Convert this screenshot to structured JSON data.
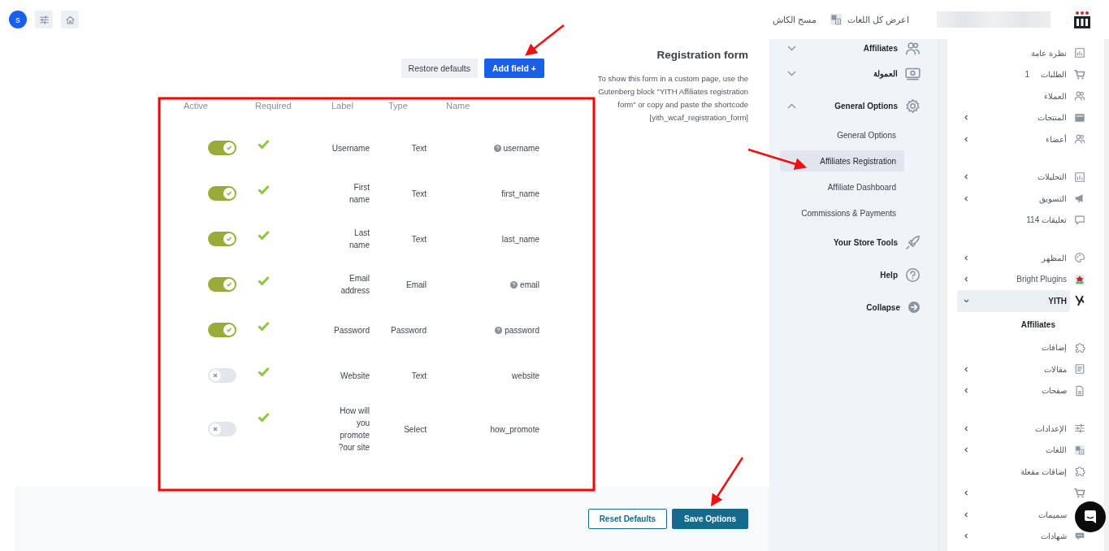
{
  "topbar": {
    "avatar": "s",
    "actions": [
      "اعرض كل اللغات",
      "مسح الكاش"
    ]
  },
  "admin_menu": {
    "groups": [
      {
        "items": [
          {
            "label": "نظرة عامة",
            "has_submenu": false,
            "selected": false
          },
          {
            "label": "الطلبات",
            "badge": "1",
            "has_submenu": false,
            "selected": false
          },
          {
            "label": "العملاء",
            "has_submenu": false,
            "selected": false
          },
          {
            "label": "المنتجات",
            "has_submenu": true,
            "selected": false
          },
          {
            "label": "أعضاء",
            "has_submenu": true,
            "selected": false
          }
        ]
      },
      {
        "items": [
          {
            "label": "التحليلات",
            "has_submenu": true,
            "selected": false
          },
          {
            "label": "التسويق",
            "has_submenu": true,
            "selected": false
          },
          {
            "label": "تعليقات 114",
            "has_submenu": false,
            "selected": false
          }
        ]
      },
      {
        "items": [
          {
            "label": "المظهر",
            "has_submenu": true,
            "selected": false
          },
          {
            "label": "Bright Plugins",
            "has_submenu": true,
            "selected": false
          },
          {
            "label": "YITH",
            "has_submenu": true,
            "selected": true,
            "children": [
              {
                "label": "Affiliates",
                "selected": true
              }
            ]
          },
          {
            "label": "إضافات",
            "has_submenu": false,
            "selected": false
          },
          {
            "label": "مقالات",
            "has_submenu": true,
            "selected": false
          },
          {
            "label": "صفحات",
            "has_submenu": true,
            "selected": false
          }
        ]
      },
      {
        "items": [
          {
            "label": "الإعدادات",
            "has_submenu": true,
            "selected": false
          },
          {
            "label": "اللغات",
            "has_submenu": true,
            "selected": false
          },
          {
            "label": "إضافات مفعلة",
            "has_submenu": false,
            "selected": false
          },
          {
            "has_submenu": true,
            "selected": false
          },
          {
            "label": "سميمات",
            "has_submenu": true,
            "selected": false
          },
          {
            "label": "شهادات",
            "has_submenu": true,
            "selected": false
          }
        ]
      }
    ]
  },
  "plugin_nav": [
    {
      "kind": "section",
      "label": "Affiliates",
      "expanded": false
    },
    {
      "kind": "section",
      "label": "العمولة",
      "expanded": false
    },
    {
      "kind": "section",
      "label": "General Options",
      "expanded": true,
      "children": [
        {
          "label": "General Options",
          "selected": false
        },
        {
          "label": "Affiliates Registration",
          "selected": true
        },
        {
          "label": "Affiliate Dashboard",
          "selected": false
        },
        {
          "label": "Commissions & Payments",
          "selected": false
        }
      ]
    },
    {
      "kind": "link",
      "label": "Your Store Tools"
    },
    {
      "kind": "link",
      "label": "Help"
    },
    {
      "kind": "link",
      "label": "Collapse"
    }
  ],
  "form": {
    "title": "Registration form",
    "description": "To show this form in a custom page, use the Gutenberg block \"YITH Affiliates registration form\" or copy and paste the shortcode [yith_wcaf_registration_form]",
    "buttons": [
      "Restore defaults",
      "Add field +"
    ],
    "table": {
      "columns": [
        "Active",
        "Required",
        "Label",
        "Type",
        "Name"
      ],
      "rows": [
        {
          "active": true,
          "required": true,
          "label": "Username",
          "type": "Text",
          "name": "username",
          "has_help": true
        },
        {
          "active": true,
          "required": true,
          "label": "First name",
          "type": "Text",
          "name": "first_name",
          "has_help": false
        },
        {
          "active": true,
          "required": true,
          "label": "Last name",
          "type": "Text",
          "name": "last_name",
          "has_help": false
        },
        {
          "active": true,
          "required": true,
          "label": "Email address",
          "type": "Email",
          "name": "email",
          "has_help": true
        },
        {
          "active": true,
          "required": true,
          "label": "Password",
          "type": "Password",
          "name": "password",
          "has_help": true
        },
        {
          "active": false,
          "required": true,
          "label": "Website",
          "type": "Text",
          "name": "website",
          "has_help": false
        },
        {
          "active": false,
          "required": true,
          "label": "How will you promote ?our site",
          "type": "Select",
          "name": "how_promote",
          "has_help": false
        }
      ]
    }
  },
  "footer_buttons": [
    "Reset Defaults",
    "Save Options"
  ]
}
